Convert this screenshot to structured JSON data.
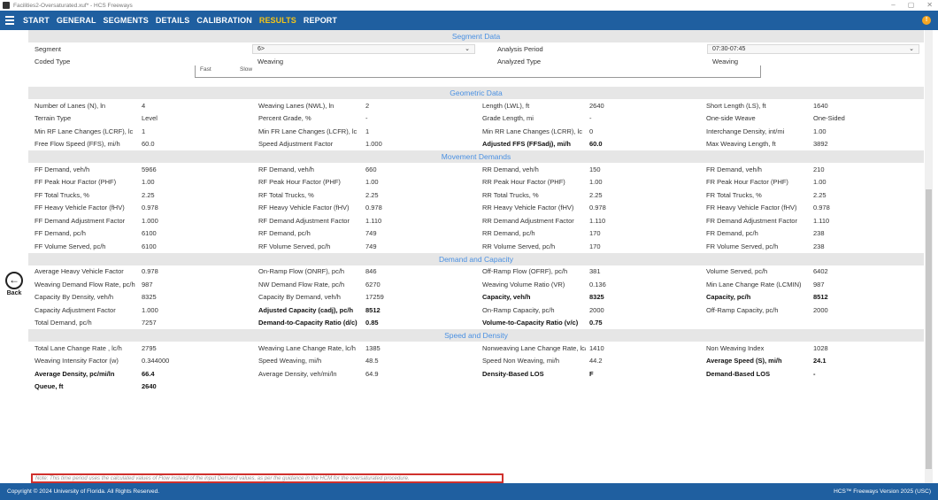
{
  "window": {
    "title": "Facilities2-Oversaturated.xuf* - HCS Freeways"
  },
  "menu": [
    "START",
    "GENERAL",
    "SEGMENTS",
    "DETAILS",
    "CALIBRATION",
    "RESULTS",
    "REPORT"
  ],
  "back_label": "Back",
  "segment_data": {
    "header": "Segment Data",
    "segment_label": "Segment",
    "segment_value": "6>",
    "analysis_period_label": "Analysis Period",
    "analysis_period_value": "07:30-07:45",
    "coded_type_label": "Coded Type",
    "coded_type_value": "Weaving",
    "analyzed_type_label": "Analyzed Type",
    "analyzed_type_value": "Weaving",
    "partial_fast": "Fast",
    "partial_slow": "Slow"
  },
  "sections": [
    {
      "header": "Geometric Data",
      "rows": [
        [
          [
            "Number of Lanes (N), ln",
            "4"
          ],
          [
            "Weaving Lanes (NWL), ln",
            "2"
          ],
          [
            "Length (LWL), ft",
            "2640"
          ],
          [
            "Short Length (LS), ft",
            "1640"
          ]
        ],
        [
          [
            "Terrain Type",
            "Level"
          ],
          [
            "Percent Grade, %",
            "-"
          ],
          [
            "Grade Length, mi",
            "-"
          ],
          [
            "One-side Weave",
            "One-Sided"
          ]
        ],
        [
          [
            "Min RF Lane Changes (LCRF), lc",
            "1"
          ],
          [
            "Min FR Lane Changes (LCFR), lc",
            "1"
          ],
          [
            "Min RR Lane Changes (LCRR), lc",
            "0"
          ],
          [
            "Interchange Density, int/mi",
            "1.00"
          ]
        ],
        [
          [
            "Free Flow Speed (FFS), mi/h",
            "60.0"
          ],
          [
            "Speed Adjustment Factor",
            "1.000"
          ],
          [
            "Adjusted FFS (FFSadj), mi/h",
            "60.0"
          ],
          [
            "Max Weaving Length, ft",
            "3892"
          ]
        ]
      ]
    },
    {
      "header": "Movement Demands",
      "rows": [
        [
          [
            "FF Demand, veh/h",
            "5966"
          ],
          [
            "RF Demand, veh/h",
            "660"
          ],
          [
            "RR Demand, veh/h",
            "150"
          ],
          [
            "FR Demand, veh/h",
            "210"
          ]
        ],
        [
          [
            "FF Peak Hour Factor (PHF)",
            "1.00"
          ],
          [
            "RF Peak Hour Factor (PHF)",
            "1.00"
          ],
          [
            "RR Peak Hour Factor (PHF)",
            "1.00"
          ],
          [
            "FR Peak Hour Factor (PHF)",
            "1.00"
          ]
        ],
        [
          [
            "FF Total Trucks, %",
            "2.25"
          ],
          [
            "RF Total Trucks, %",
            "2.25"
          ],
          [
            "RR Total Trucks, %",
            "2.25"
          ],
          [
            "FR Total Trucks, %",
            "2.25"
          ]
        ],
        [
          [
            "FF Heavy Vehicle Factor (fHV)",
            "0.978"
          ],
          [
            "RF Heavy Vehicle Factor (fHV)",
            "0.978"
          ],
          [
            "RR Heavy Vehicle Factor (fHV)",
            "0.978"
          ],
          [
            "FR Heavy Vehicle Factor (fHV)",
            "0.978"
          ]
        ],
        [
          [
            "FF Demand Adjustment Factor",
            "1.000"
          ],
          [
            "RF Demand Adjustment Factor",
            "1.110"
          ],
          [
            "RR Demand Adjustment Factor",
            "1.110"
          ],
          [
            "FR Demand Adjustment Factor",
            "1.110"
          ]
        ],
        [
          [
            "FF Demand, pc/h",
            "6100"
          ],
          [
            "RF Demand, pc/h",
            "749"
          ],
          [
            "RR Demand, pc/h",
            "170"
          ],
          [
            "FR Demand, pc/h",
            "238"
          ]
        ],
        [
          [
            "FF Volume Served, pc/h",
            "6100"
          ],
          [
            "RF Volume Served, pc/h",
            "749"
          ],
          [
            "RR Volume Served, pc/h",
            "170"
          ],
          [
            "FR Volume Served, pc/h",
            "238"
          ]
        ]
      ]
    },
    {
      "header": "Demand and Capacity",
      "rows": [
        [
          [
            "Average Heavy Vehicle Factor",
            "0.978"
          ],
          [
            "On-Ramp Flow (ONRF), pc/h",
            "846"
          ],
          [
            "Off-Ramp Flow (OFRF), pc/h",
            "381"
          ],
          [
            "Volume Served, pc/h",
            "6402"
          ]
        ],
        [
          [
            "Weaving Demand Flow Rate, pc/h",
            "987"
          ],
          [
            "NW Demand Flow Rate, pc/h",
            "6270"
          ],
          [
            "Weaving Volume Ratio (VR)",
            "0.136"
          ],
          [
            "Min Lane Change Rate (LCMIN)",
            "987"
          ]
        ],
        [
          [
            "Capacity By Density, veh/h",
            "8325"
          ],
          [
            "Capacity By Demand, veh/h",
            "17259"
          ],
          [
            "Capacity, veh/h",
            "8325"
          ],
          [
            "Capacity, pc/h",
            "8512"
          ]
        ],
        [
          [
            "Capacity Adjustment Factor",
            "1.000"
          ],
          [
            "Adjusted Capacity (cadj), pc/h",
            "8512"
          ],
          [
            "On-Ramp Capacity, pc/h",
            "2000"
          ],
          [
            "Off-Ramp Capacity, pc/h",
            "2000"
          ]
        ],
        [
          [
            "Total Demand, pc/h",
            "7257"
          ],
          [
            "Demand-to-Capacity Ratio (d/c)",
            "0.85"
          ],
          [
            "Volume-to-Capacity Ratio (v/c)",
            "0.75"
          ],
          [
            "",
            ""
          ]
        ]
      ]
    },
    {
      "header": "Speed and Density",
      "rows": [
        [
          [
            "Total Lane Change Rate , lc/h",
            "2795"
          ],
          [
            "Weaving Lane Change Rate, lc/h",
            "1385"
          ],
          [
            "Nonweaving Lane Change Rate, lc/h",
            "1410"
          ],
          [
            "Non Weaving Index",
            "1028"
          ]
        ],
        [
          [
            "Weaving Intensity Factor (w)",
            "0.344000"
          ],
          [
            "Speed Weaving, mi/h",
            "48.5"
          ],
          [
            "Speed Non Weaving, mi/h",
            "44.2"
          ],
          [
            "Average Speed (S), mi/h",
            "24.1"
          ]
        ],
        [
          [
            "Average Density, pc/mi/ln",
            "66.4"
          ],
          [
            "Average Density, veh/mi/ln",
            "64.9"
          ],
          [
            "Density-Based LOS",
            "F"
          ],
          [
            "Demand-Based LOS",
            "-"
          ]
        ],
        [
          [
            "Queue, ft",
            "2640"
          ],
          [
            "",
            ""
          ],
          [
            "",
            ""
          ],
          [
            "",
            ""
          ]
        ]
      ]
    }
  ],
  "note": "Note: This time period uses the calculated values of Flow instead of the input Demand values, as per the guidance in the HCM for the oversaturated procedure.",
  "footer": {
    "left": "Copyright © 2024 University of Florida. All Rights Reserved.",
    "right": "HCS™ Freeways Version 2025 (USC)"
  }
}
